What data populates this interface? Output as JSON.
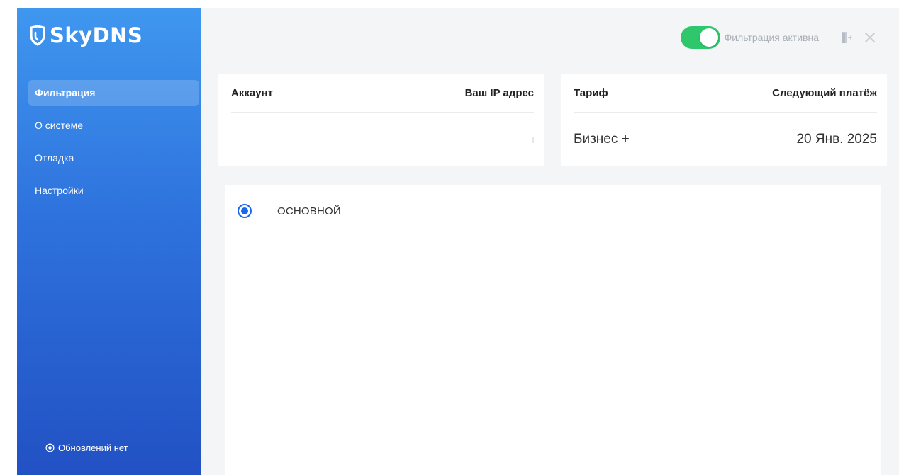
{
  "app": {
    "logo_text": "SkyDNS"
  },
  "sidebar": {
    "items": [
      {
        "label": "Фильтрация",
        "active": true
      },
      {
        "label": "О системе",
        "active": false
      },
      {
        "label": "Отладка",
        "active": false
      },
      {
        "label": "Настройки",
        "active": false
      }
    ],
    "update_status": "Обновлений нет"
  },
  "topbar": {
    "filter_toggle_on": true,
    "filter_label": "Фильтрация активна"
  },
  "account_card": {
    "account_header": "Аккаунт",
    "ip_header": "Ваш IP адрес",
    "account_value": "",
    "ip_value": ""
  },
  "tariff_card": {
    "tariff_header": "Тариф",
    "next_payment_header": "Следующий платёж",
    "tariff_value": "Бизнес +",
    "next_payment_value": "20 Янв. 2025"
  },
  "profiles": [
    {
      "label": "ОСНОВНОЙ",
      "selected": true
    }
  ],
  "colors": {
    "sidebar_top": "#3f97ef",
    "sidebar_bottom": "#2251c4",
    "toggle_on": "#2ec76b",
    "radio_accent": "#1a66ee",
    "content_bg": "#f4f5f7"
  }
}
